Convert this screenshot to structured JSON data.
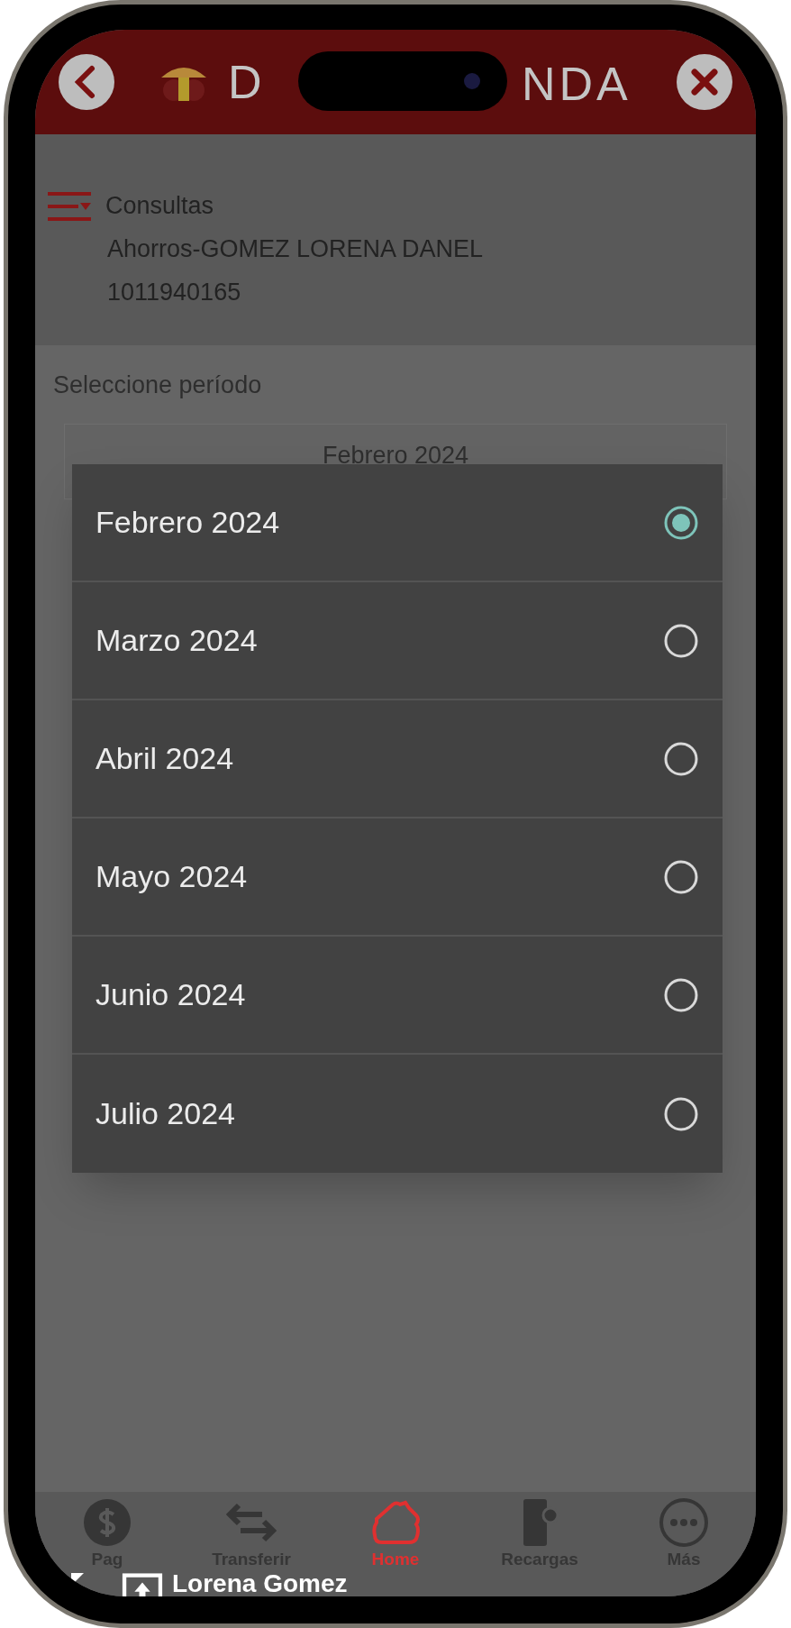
{
  "header": {
    "logo_left": "D",
    "logo_right": "NDA"
  },
  "account": {
    "title": "Consultas",
    "name": "Ahorros-GOMEZ LORENA DANEL",
    "number": "1011940165"
  },
  "period": {
    "label": "Seleccione período",
    "value": "Febrero 2024"
  },
  "options": [
    {
      "label": "Febrero 2024",
      "selected": true
    },
    {
      "label": "Marzo 2024",
      "selected": false
    },
    {
      "label": "Abril 2024",
      "selected": false
    },
    {
      "label": "Mayo 2024",
      "selected": false
    },
    {
      "label": "Junio 2024",
      "selected": false
    },
    {
      "label": "Julio 2024",
      "selected": false
    }
  ],
  "nav": [
    {
      "label": "Pag",
      "kind": "payments",
      "selected": false
    },
    {
      "label": "Transferir",
      "kind": "transfer",
      "selected": false
    },
    {
      "label": "Home",
      "kind": "home",
      "selected": true
    },
    {
      "label": "Recargas",
      "kind": "topup",
      "selected": false
    },
    {
      "label": "Más",
      "kind": "more",
      "selected": false
    }
  ],
  "overlay": {
    "user_name": "Lorena Gomez"
  }
}
